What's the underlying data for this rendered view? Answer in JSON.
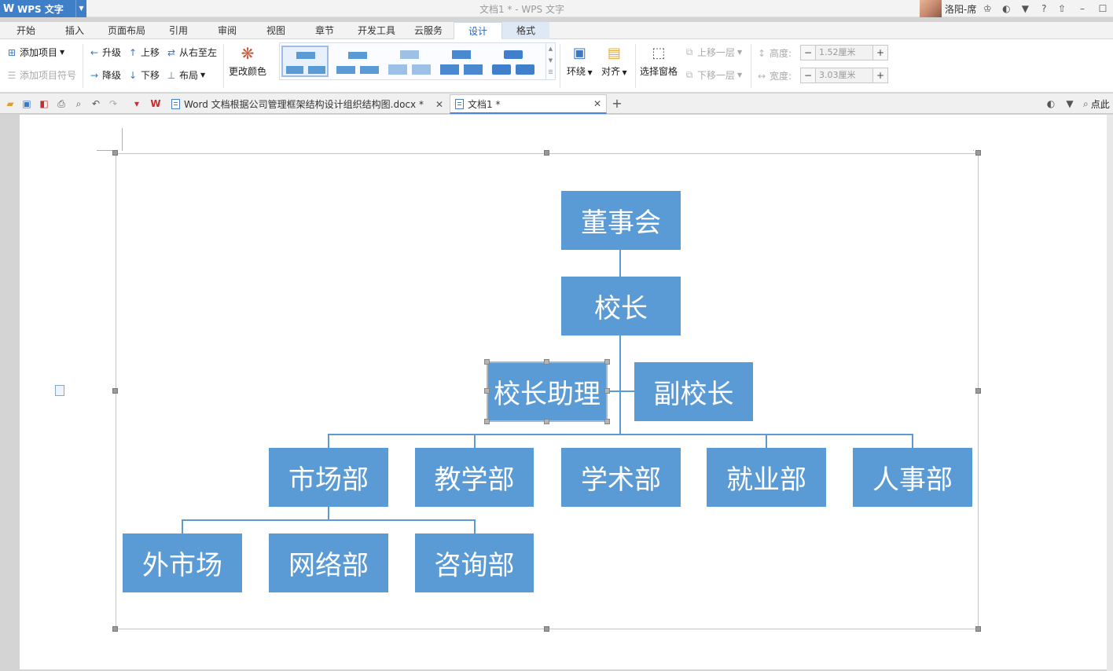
{
  "app": {
    "name": "WPS 文字",
    "window_title": "文档1 * - WPS 文字"
  },
  "user": {
    "name": "洛阳-席"
  },
  "menu_tabs": [
    {
      "label": "开始"
    },
    {
      "label": "插入"
    },
    {
      "label": "页面布局"
    },
    {
      "label": "引用"
    },
    {
      "label": "审阅"
    },
    {
      "label": "视图"
    },
    {
      "label": "章节"
    },
    {
      "label": "开发工具"
    },
    {
      "label": "云服务"
    },
    {
      "label": "设计"
    },
    {
      "label": "格式"
    }
  ],
  "ribbon": {
    "add_item": "添加项目",
    "add_bullet": "添加项目符号",
    "promote": "升级",
    "demote": "降级",
    "move_up": "上移",
    "move_down": "下移",
    "right_to_left": "从右至左",
    "layout": "布局",
    "change_colors": "更改颜色",
    "wrap": "环绕",
    "align": "对齐",
    "selection_pane": "选择窗格",
    "bring_forward": "上移一层",
    "send_backward": "下移一层",
    "height_label": "高度:",
    "height_value": "1.52厘米",
    "width_label": "宽度:",
    "width_value": "3.03厘米"
  },
  "doc_tabs": [
    {
      "label": "Word 文档根据公司管理框架结构设计组织结构图.docx *",
      "active": false
    },
    {
      "label": "文档1 *",
      "active": true
    }
  ],
  "tabbar_right": {
    "search_text": "点此"
  },
  "org_chart": {
    "accent_color": "#5b9bd5",
    "nodes": {
      "board": "董事会",
      "principal": "校长",
      "assistant": "校长助理",
      "vice_principal": "副校长",
      "marketing": "市场部",
      "teaching": "教学部",
      "academic": "学术部",
      "employment": "就业部",
      "hr": "人事部",
      "external_market": "外市场",
      "network": "网络部",
      "consulting": "咨询部"
    },
    "selected_node": "校长助理"
  }
}
